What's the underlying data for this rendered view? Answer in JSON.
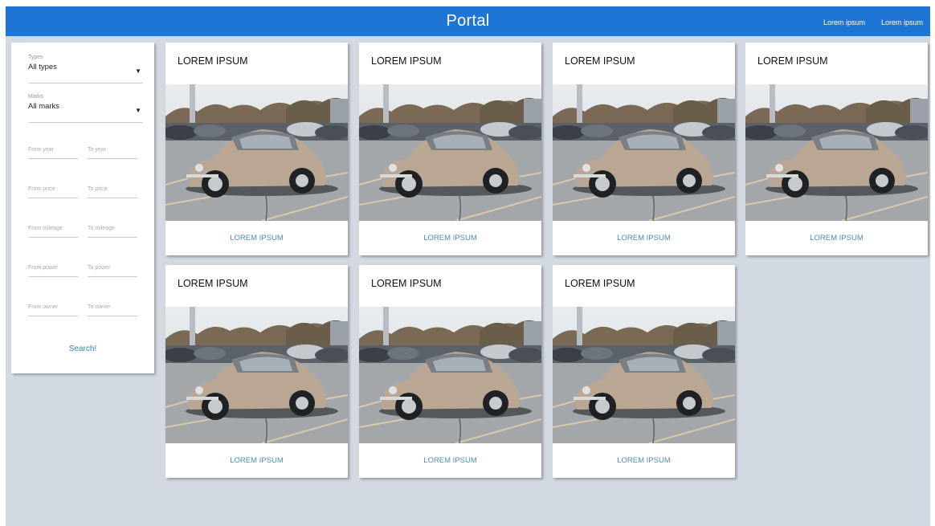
{
  "header": {
    "title": "Portal",
    "nav_links": [
      "Lorem ipsum",
      "Lorem ipsum"
    ]
  },
  "filters": {
    "types": {
      "label": "Types",
      "value": "All types"
    },
    "marks": {
      "label": "Marks",
      "value": "All marks"
    },
    "ranges": [
      {
        "from": "From year",
        "to": "To year"
      },
      {
        "from": "From price",
        "to": "To price"
      },
      {
        "from": "From mileage",
        "to": "To mileage"
      },
      {
        "from": "From power",
        "to": "To power"
      },
      {
        "from": "From owner",
        "to": "To owner"
      }
    ],
    "search_label": "Search!"
  },
  "cards": [
    {
      "title": "LOREM IPSUM",
      "link": "LOREM IPSUM"
    },
    {
      "title": "LOREM IPSUM",
      "link": "LOREM IPSUM"
    },
    {
      "title": "LOREM IPSUM",
      "link": "LOREM IPSUM"
    },
    {
      "title": "LOREM IPSUM",
      "link": "LOREM IPSUM"
    },
    {
      "title": "LOREM IPSUM",
      "link": "LOREM IPSUM"
    },
    {
      "title": "LOREM IPSUM",
      "link": "LOREM IPSUM"
    },
    {
      "title": "LOREM IPSUM",
      "link": "LOREM IPSUM"
    }
  ],
  "colors": {
    "header_bar": "#1f75d6",
    "background": "#d3d9e0",
    "link": "#4c90aa",
    "car_body": "#b9a794"
  },
  "icons": {
    "dropdown": "triangle-down-icon",
    "card_image": "car-photo"
  }
}
